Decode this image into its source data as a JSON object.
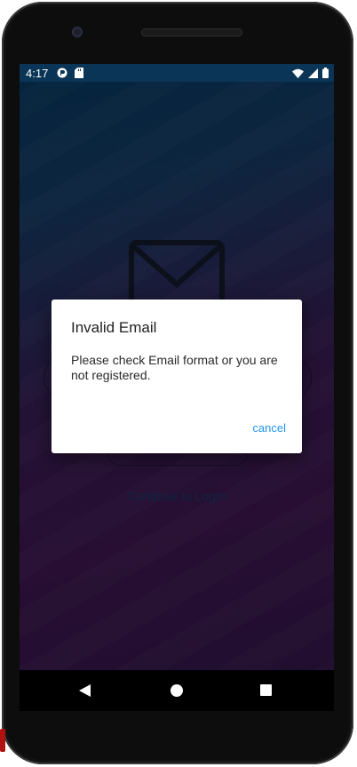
{
  "statusbar": {
    "time": "4:17",
    "left_icons": [
      "app-notification-icon",
      "sd-card-icon"
    ],
    "right_icons": [
      "wifi-icon",
      "cell-signal-icon",
      "battery-icon"
    ]
  },
  "background_screen": {
    "icon": "mail-icon",
    "continue_label": "Continue to Login"
  },
  "dialog": {
    "title": "Invalid Email",
    "message": "Please check Email format or you are not registered.",
    "cancel_label": "cancel"
  },
  "navbar": {
    "buttons": [
      "back-icon",
      "home-icon",
      "recents-icon"
    ]
  },
  "colors": {
    "gradient_top": "#073b63",
    "gradient_bottom": "#35174d",
    "dialog_action": "#2196f3",
    "scrim": "rgba(0,0,0,0.38)"
  }
}
